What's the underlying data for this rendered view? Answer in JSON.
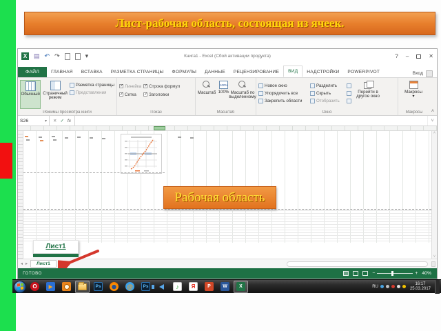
{
  "slide": {
    "title": "Лист-рабочая область, состоящая из ячеек.",
    "area_label": "Рабочая область",
    "callout_sheet_label": "Лист1"
  },
  "excel": {
    "titlebar": {
      "title": "Книга1 - Excel (Сбой активации продукта)"
    },
    "tabs": [
      "ФАЙЛ",
      "ГЛАВНАЯ",
      "ВСТАВКА",
      "РАЗМЕТКА СТРАНИЦЫ",
      "ФОРМУЛЫ",
      "ДАННЫЕ",
      "РЕЦЕНЗИРОВАНИЕ",
      "ВИД",
      "НАДСТРОЙКИ",
      "POWERPIVOT"
    ],
    "signin_label": "Вход",
    "ribbon": {
      "groups": [
        {
          "label": "Режимы просмотра книги"
        },
        {
          "label": "Показ"
        },
        {
          "label": "Масштаб"
        },
        {
          "label": "Окно"
        },
        {
          "label": "Макросы"
        }
      ],
      "views": {
        "normal": "Обычный",
        "page_break": "Страничный режим",
        "page_layout": "Разметка страницы",
        "custom": "Представления"
      },
      "show": {
        "ruler": "Линейка",
        "formula_bar": "Строка формул",
        "gridlines": "Сетка",
        "headings": "Заголовки"
      },
      "zoom": {
        "zoom": "Масштаб",
        "hundred": "100%",
        "to_selection": "Масштаб по выделенному"
      },
      "window": {
        "new_window": "Новое окно",
        "arrange_all": "Упорядочить все",
        "freeze": "Закрепить области",
        "split": "Разделить",
        "hide": "Скрыть",
        "unhide": "Отобразить",
        "switch": "Перейти в другое окно"
      },
      "macros": "Макросы"
    },
    "formula": {
      "name_box": "S26"
    },
    "sheet_tab": "Лист1",
    "status": {
      "ready": "ГОТОВО",
      "zoom": "40%"
    }
  },
  "taskbar": {
    "lang": "RU",
    "time": "16:17",
    "date": "25.03.2017",
    "icons": {
      "opera": "O",
      "player": "▶",
      "photoshop": "Ps",
      "mail": "@",
      "note": "♪",
      "yandex": "Я",
      "powerpoint": "P",
      "word": "W",
      "excel": "X"
    }
  },
  "glyphs": {
    "excel_logo": "X",
    "save": "▤",
    "undo": "↶",
    "redo": "↷",
    "dropdown": "▾",
    "help": "?",
    "minimize": "–",
    "close": "✕",
    "cancel": "✕",
    "check": "✓",
    "fx": "fx",
    "expand": "˅",
    "collapse": "˄",
    "left": "◂",
    "right": "▸",
    "plus": "+",
    "minus": "−"
  }
}
